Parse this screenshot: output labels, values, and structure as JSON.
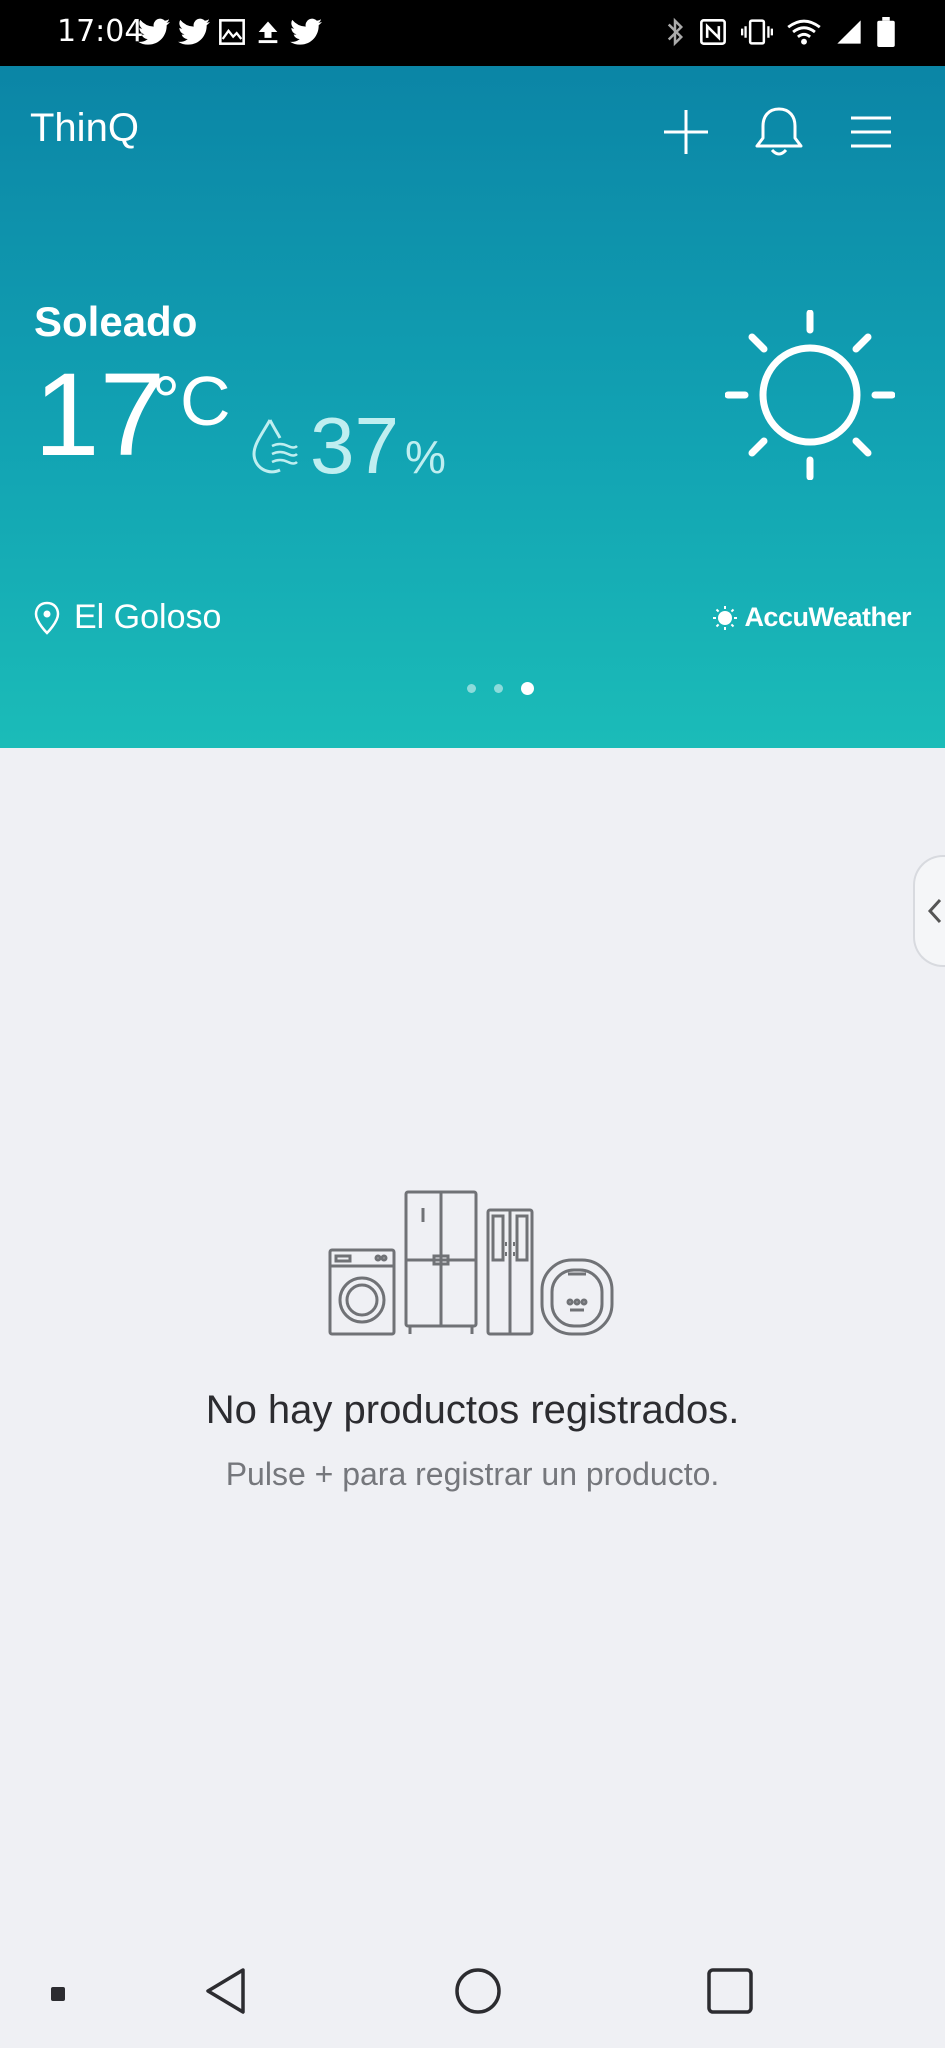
{
  "status_bar": {
    "time": "17:04",
    "left_icons": [
      "twitter-icon",
      "twitter-icon",
      "image-icon",
      "upload-icon",
      "twitter-icon"
    ],
    "right_icons": [
      "bluetooth-icon",
      "nfc-icon",
      "vibrate-icon",
      "wifi-icon",
      "signal-icon",
      "battery-icon"
    ]
  },
  "header": {
    "app_title": "ThinQ",
    "add_icon": "plus-icon",
    "notifications_icon": "bell-icon",
    "menu_icon": "hamburger-menu-icon"
  },
  "weather": {
    "condition": "Soleado",
    "temperature": "17",
    "temperature_unit": "°C",
    "humidity": "37",
    "humidity_unit": "%",
    "location": "El Goloso",
    "provider": "AccuWeather",
    "weather_icon": "sun-icon",
    "page_count": 3,
    "active_page": 3
  },
  "empty_state": {
    "title": "No hay productos registrados.",
    "subtitle": "Pulse + para registrar un producto.",
    "illustration": "appliances-icon"
  },
  "nav_bar": {
    "items": [
      "square-dot-icon",
      "back-icon",
      "home-icon",
      "recents-icon"
    ]
  },
  "colors": {
    "header_top": "#0b85a6",
    "header_bottom": "#1bbcb8",
    "background": "#eff0f4",
    "text_primary": "#2c2c30",
    "text_secondary": "#75777c"
  }
}
